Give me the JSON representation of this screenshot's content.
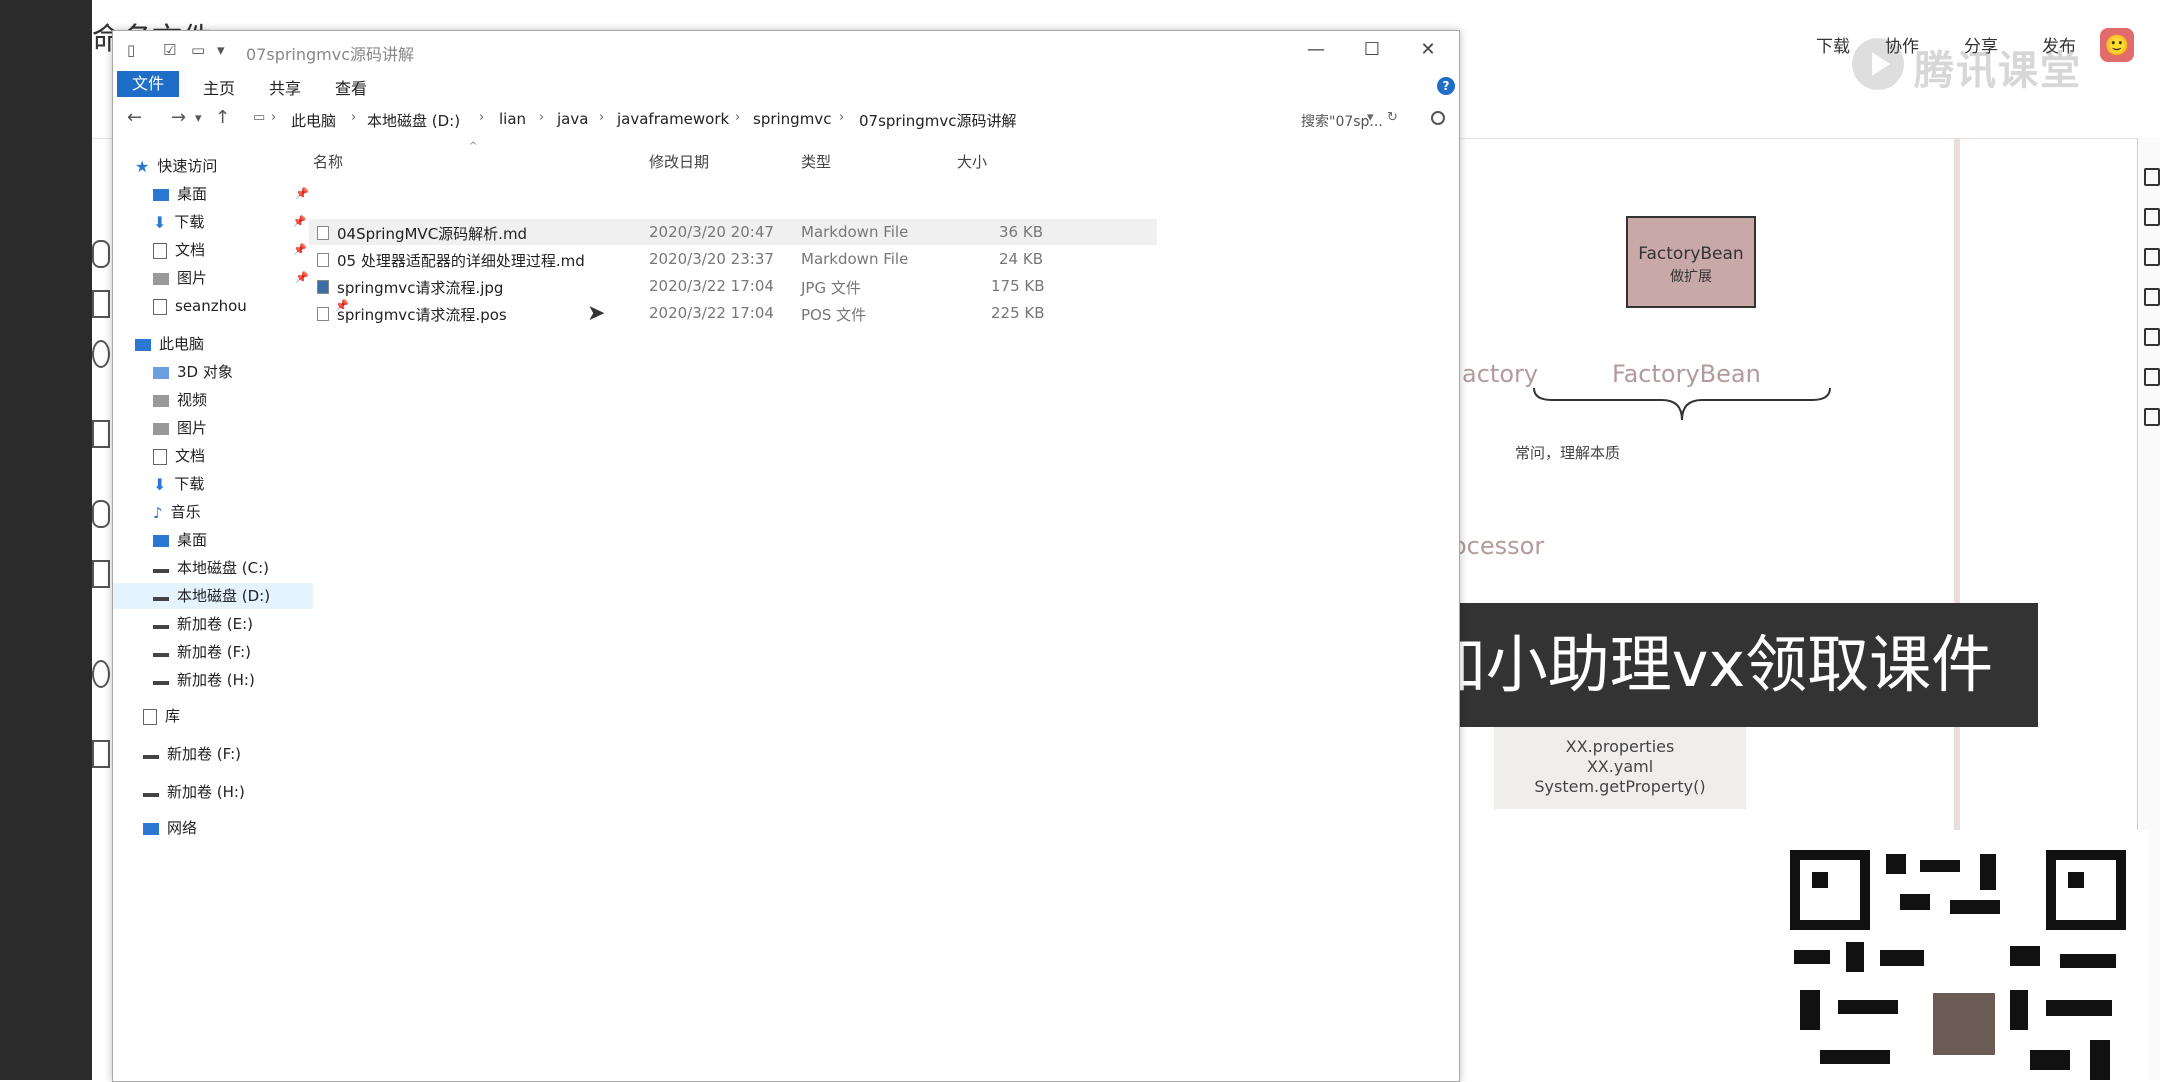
{
  "background_app": {
    "title": "命名文件",
    "top_buttons": [
      "下载",
      "协作",
      "分享",
      "发布"
    ],
    "avatar": "🙂",
    "logo_text": "腾讯课堂",
    "canvas": {
      "factorybean_box": {
        "line1": "FactoryBean",
        "line2": "做扩展"
      },
      "text_factory": "actory",
      "text_factorybean": "FactoryBean",
      "brace_caption": "常问，理解本质",
      "text_processor": "ocessor",
      "note_lines": [
        "XX.properties",
        "XX.yaml",
        "System.getProperty()"
      ]
    }
  },
  "banner": {
    "text": "扫码添加小助理vx领取课件"
  },
  "explorer": {
    "title": "07springmvc源码讲解",
    "ribbon_tabs": [
      "文件",
      "主页",
      "共享",
      "查看"
    ],
    "window_buttons": [
      "—",
      "☐",
      "✕"
    ],
    "breadcrumb": [
      "此电脑",
      "本地磁盘 (D:)",
      "lian",
      "java",
      "javaframework",
      "springmvc",
      "07springmvc源码讲解"
    ],
    "search_placeholder": "搜索\"07sp...",
    "nav": {
      "quick_access": "快速访问",
      "quick_items": [
        "桌面",
        "下载",
        "文档",
        "图片",
        "seanzhou"
      ],
      "this_pc": "此电脑",
      "pc_items": [
        "3D 对象",
        "视频",
        "图片",
        "文档",
        "下载",
        "音乐",
        "桌面",
        "本地磁盘 (C:)",
        "本地磁盘 (D:)",
        "新加卷 (E:)",
        "新加卷 (F:)",
        "新加卷 (H:)"
      ],
      "library": "库",
      "extra_drives": [
        "新加卷 (F:)",
        "新加卷 (H:)"
      ],
      "network": "网络"
    },
    "columns": {
      "name": "名称",
      "date": "修改日期",
      "type": "类型",
      "size": "大小"
    },
    "files": [
      {
        "name": "04SpringMVC源码解析.md",
        "date": "2020/3/20 20:47",
        "type": "Markdown File",
        "size": "36 KB"
      },
      {
        "name": "05 处理器适配器的详细处理过程.md",
        "date": "2020/3/20 23:37",
        "type": "Markdown File",
        "size": "24 KB"
      },
      {
        "name": "springmvc请求流程.jpg",
        "date": "2020/3/22 17:04",
        "type": "JPG 文件",
        "size": "175 KB"
      },
      {
        "name": "springmvc请求流程.pos",
        "date": "2020/3/22 17:04",
        "type": "POS 文件",
        "size": "225 KB"
      }
    ]
  }
}
